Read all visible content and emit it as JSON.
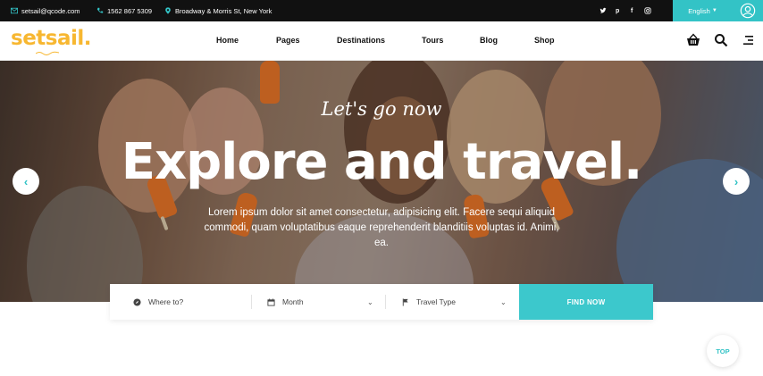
{
  "topbar": {
    "email": "setsail@qcode.com",
    "phone": "1562 867 5309",
    "address": "Broadway & Morris St, New York",
    "social": [
      "twitter-icon",
      "pinterest-icon",
      "facebook-icon",
      "instagram-icon"
    ],
    "language": "English"
  },
  "header": {
    "logo": "setsail.",
    "nav": [
      "Home",
      "Pages",
      "Destinations",
      "Tours",
      "Blog",
      "Shop"
    ]
  },
  "hero": {
    "script_title": "Let's go now",
    "headline": "Explore and travel.",
    "subtext": "Lorem ipsum dolor sit amet consectetur, adipisicing elit. Facere sequi aliquid commodi, quam voluptatibus eaque reprehenderit blanditiis voluptas id. Animi, ea."
  },
  "search": {
    "destination_placeholder": "Where to?",
    "month_placeholder": "Month",
    "type_placeholder": "Travel Type",
    "button": "FIND NOW"
  },
  "scroll_top": "TOP",
  "colors": {
    "accent": "#33c3c6",
    "logo": "#f7b731",
    "topbar": "#111111"
  }
}
